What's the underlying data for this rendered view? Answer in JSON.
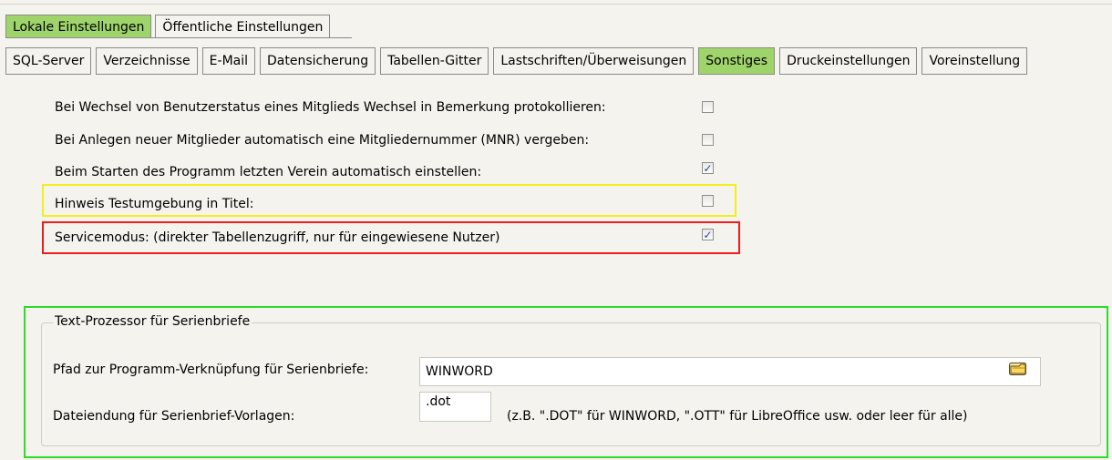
{
  "top_tabs": [
    {
      "label": "Lokale Einstellungen",
      "active": true
    },
    {
      "label": "Öffentliche Einstellungen",
      "active": false
    }
  ],
  "sub_tabs": [
    {
      "label": "SQL-Server",
      "active": false
    },
    {
      "label": "Verzeichnisse",
      "active": false
    },
    {
      "label": "E-Mail",
      "active": false
    },
    {
      "label": "Datensicherung",
      "active": false
    },
    {
      "label": "Tabellen-Gitter",
      "active": false
    },
    {
      "label": "Lastschriften/Überweisungen",
      "active": false
    },
    {
      "label": "Sonstiges",
      "active": true
    },
    {
      "label": "Druckeinstellungen",
      "active": false
    },
    {
      "label": "Voreinstellung",
      "active": false
    }
  ],
  "options": [
    {
      "label": "Bei Wechsel von Benutzerstatus eines Mitglieds Wechsel in Bemerkung protokollieren:",
      "checked": false
    },
    {
      "label": "Bei Anlegen neuer Mitglieder automatisch eine Mitgliedernummer (MNR) vergeben:",
      "checked": false
    },
    {
      "label": "Beim Starten des Programm letzten Verein automatisch einstellen:",
      "checked": true
    },
    {
      "label": "Hinweis Testumgebung in Titel:",
      "checked": false
    },
    {
      "label": "Servicemodus: (direkter Tabellenzugriff, nur für eingewiesene Nutzer)",
      "checked": true
    }
  ],
  "text_processor": {
    "group_title": "Text-Prozessor für Serienbriefe",
    "path_label": "Pfad zur Programm-Verknüpfung für Serienbriefe:",
    "path_value": "WINWORD",
    "ext_label": "Dateiendung für Serienbrief-Vorlagen:",
    "ext_value": ".dot",
    "ext_note": "(z.B. \".DOT\" für WINWORD, \".OTT\" für LibreOffice usw. oder leer für alle)"
  },
  "colors": {
    "active_tab": "#9fd46b",
    "highlight_yellow": "#f2ef1a",
    "highlight_red": "#ee1c1c",
    "highlight_green": "#2bdc2b",
    "check_mark": "#2a45a8"
  },
  "icons": {
    "browse": "folder-open-icon",
    "check": "check-icon"
  }
}
